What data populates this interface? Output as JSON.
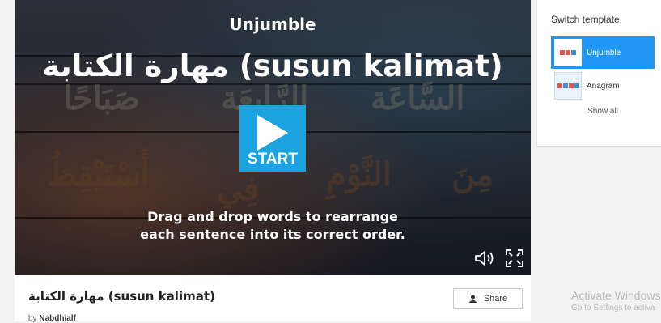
{
  "player": {
    "template_name": "Unjumble",
    "activity_name": "مهارة الكتابة (susun kalimat)",
    "start_label": "START",
    "instructions_line1": "Drag and drop words to rearrange",
    "instructions_line2": "each sentence into its correct order.",
    "speaker_icon": "speaker-icon",
    "fullscreen_icon": "fullscreen-icon",
    "start_color": "#1ba3e0"
  },
  "activity": {
    "title": "مهارة الكتابة (susun kalimat)",
    "share_label": "Share",
    "byline_prefix": "by",
    "author": "Nabdhialf"
  },
  "template_panel": {
    "heading": "Switch template",
    "items": [
      {
        "label": "Unjumble",
        "active": true
      },
      {
        "label": "Anagram",
        "active": false
      }
    ],
    "show_all": "Show all",
    "accent": "#2196f3"
  },
  "watermark": {
    "line1": "Activate Windows",
    "line2": "Go to Settings to activa"
  }
}
